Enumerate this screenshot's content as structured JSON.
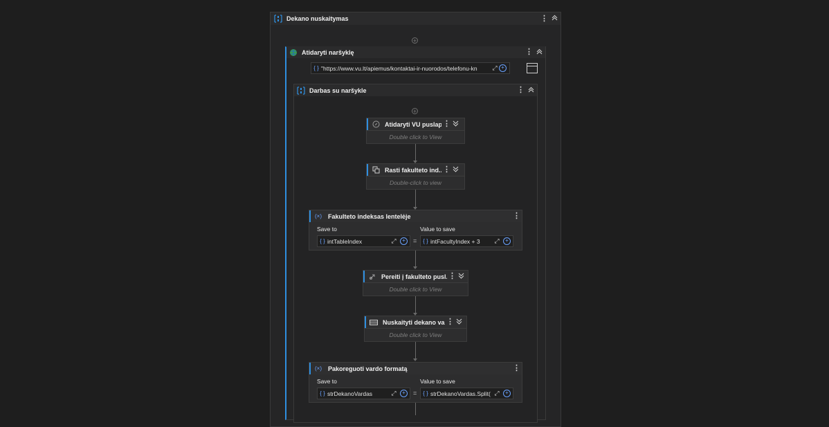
{
  "sequence": {
    "title": "Dekano nuskaitymas"
  },
  "open_browser": {
    "title": "Atidaryti naršyklę",
    "url_value": "\"https://www.vu.lt/apiemus/kontaktai-ir-nuorodos/telefonu-kn"
  },
  "browser_scope": {
    "title": "Darbas su naršykle"
  },
  "activities": [
    {
      "title": "Atidaryti VU puslapį",
      "hint": "Double click to View"
    },
    {
      "title": "Rasti fakulteto ind...",
      "hint": "Double-click to view"
    },
    {
      "title": "Pereiti į fakulteto pusl...",
      "hint": "Double click to View"
    },
    {
      "title": "Nuskaityti dekano va...",
      "hint": "Double click to View"
    }
  ],
  "assigns": [
    {
      "title": "Fakulteto indeksas lentelėje",
      "save_to_label": "Save to",
      "value_label": "Value to save",
      "save_to": "intTableIndex",
      "value": "intFacultyIndex + 3",
      "equals": "="
    },
    {
      "title": "Pakoreguoti vardo formatą",
      "save_to_label": "Save to",
      "value_label": "Value to save",
      "save_to": "strDekanoVardas",
      "value": "strDekanoVardas.Split(",
      "equals": "="
    }
  ],
  "glyphs": {
    "kebab": "⋮",
    "collapse": "«",
    "expand": "»",
    "brace": "{ }",
    "expand_field": "⤢",
    "plus": "+",
    "assign_icon": "(×)"
  },
  "colors": {
    "accent": "#2f8fe0",
    "background": "#1e1e1e",
    "panel": "#252526"
  }
}
